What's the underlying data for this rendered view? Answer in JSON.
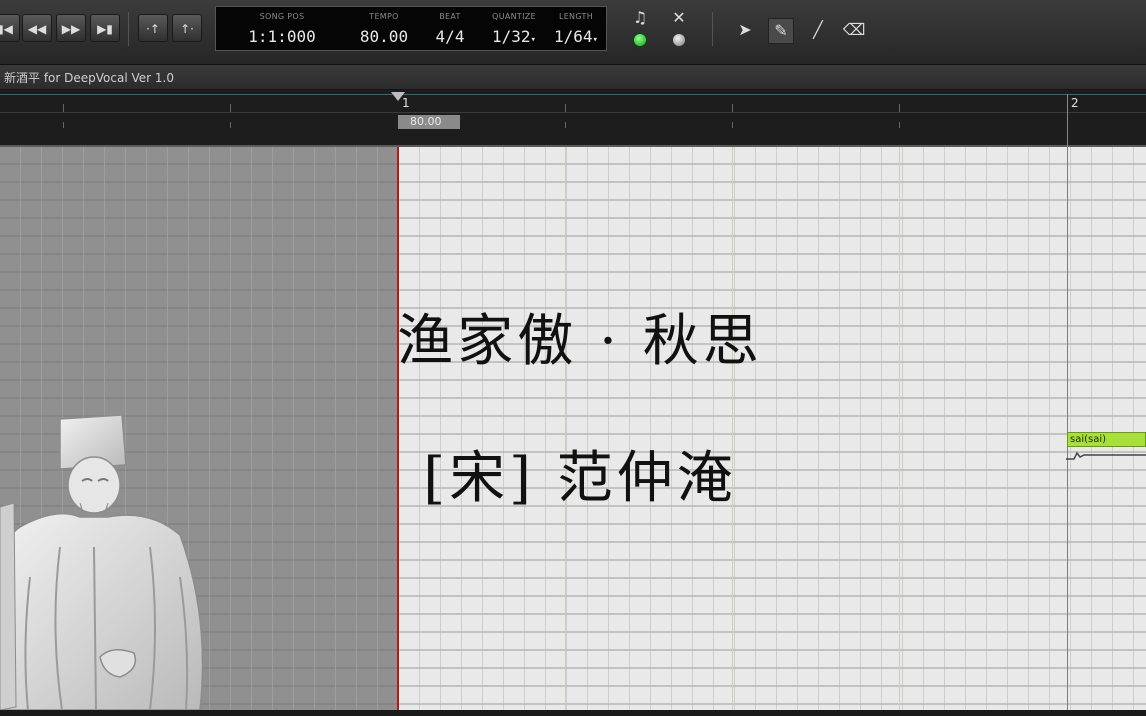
{
  "toolbar": {
    "transport": [
      {
        "name": "to-start",
        "glyph": "⏮"
      },
      {
        "name": "rewind",
        "glyph": "◀◀"
      },
      {
        "name": "fast-forward",
        "glyph": "▶▶"
      },
      {
        "name": "to-end",
        "glyph": "⏭"
      }
    ],
    "lcd": {
      "song_pos_label": "SONG POS",
      "song_pos": "1:1:000",
      "tempo_label": "TEMPO",
      "tempo": "80.00",
      "beat_label": "BEAT",
      "beat": "4/4",
      "quantize_label": "QUANTIZE",
      "quantize": "1/32",
      "length_label": "LENGTH",
      "length": "1/64"
    },
    "colors": {
      "led_green": "#2ecc40",
      "led_grey": "#b0b0b0"
    }
  },
  "title_bar": {
    "text": "新酒平 for DeepVocal  Ver 1.0"
  },
  "ruler": {
    "bar_1": "1",
    "bar_2": "2",
    "tempo_marker": "80.00"
  },
  "overlay": {
    "poem_title": "渔家傲 · 秋思",
    "poem_author": "[宋] 范仲淹"
  },
  "note": {
    "lyric": "sai(sai)",
    "color": "#a8e03a"
  },
  "colors": {
    "playhead": "#b81818",
    "grid_light": "#e9e9e9",
    "grid_dark": "#c3c3c3"
  }
}
